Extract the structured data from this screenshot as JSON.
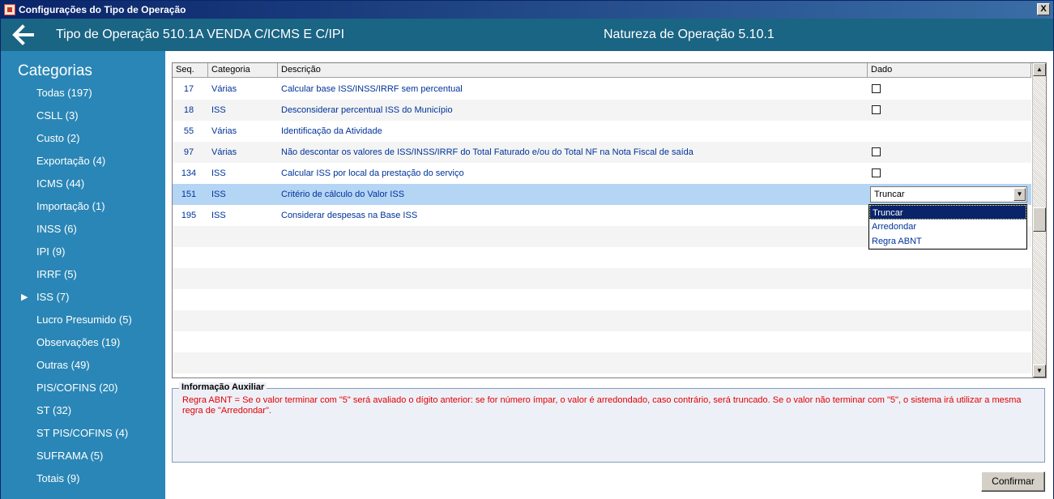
{
  "window": {
    "title": "Configurações do Tipo de Operação",
    "close_label": "X"
  },
  "header": {
    "operation_title": "Tipo de Operação 510.1A  VENDA C/ICMS E C/IPI",
    "nature_title": "Natureza de Operação 5.10.1"
  },
  "sidebar": {
    "title": "Categorias",
    "selected_index": 9,
    "items": [
      {
        "label": "Todas (197)"
      },
      {
        "label": "CSLL (3)"
      },
      {
        "label": "Custo (2)"
      },
      {
        "label": "Exportação (4)"
      },
      {
        "label": "ICMS (44)"
      },
      {
        "label": "Importação (1)"
      },
      {
        "label": "INSS (6)"
      },
      {
        "label": "IPI (9)"
      },
      {
        "label": "IRRF (5)"
      },
      {
        "label": "ISS (7)"
      },
      {
        "label": "Lucro Presumido (5)"
      },
      {
        "label": "Observações (19)"
      },
      {
        "label": "Outras (49)"
      },
      {
        "label": "PIS/COFINS (20)"
      },
      {
        "label": "ST (32)"
      },
      {
        "label": "ST PIS/COFINS (4)"
      },
      {
        "label": "SUFRAMA (5)"
      },
      {
        "label": "Totais (9)"
      }
    ]
  },
  "grid": {
    "columns": {
      "seq": "Seq.",
      "categoria": "Categoria",
      "descricao": "Descrição",
      "dado": "Dado"
    },
    "rows": [
      {
        "seq": "17",
        "categoria": "Várias",
        "descricao": "Calcular base ISS/INSS/IRRF sem percentual",
        "dado_type": "checkbox",
        "checked": false
      },
      {
        "seq": "18",
        "categoria": "ISS",
        "descricao": "Desconsiderar percentual ISS do Município",
        "dado_type": "checkbox",
        "checked": false
      },
      {
        "seq": "55",
        "categoria": "Várias",
        "descricao": "Identificação da Atividade",
        "dado_type": "none"
      },
      {
        "seq": "97",
        "categoria": "Várias",
        "descricao": "Não descontar os valores de ISS/INSS/IRRF do Total Faturado e/ou do Total NF na Nota Fiscal de saída",
        "dado_type": "checkbox",
        "checked": false
      },
      {
        "seq": "134",
        "categoria": "ISS",
        "descricao": "Calcular ISS por local da prestação do serviço",
        "dado_type": "checkbox",
        "checked": false
      },
      {
        "seq": "151",
        "categoria": "ISS",
        "descricao": "Critério de cálculo do Valor ISS",
        "dado_type": "combo",
        "value": "Truncar"
      },
      {
        "seq": "195",
        "categoria": "ISS",
        "descricao": "Considerar despesas na Base ISS",
        "dado_type": "none"
      }
    ],
    "dropdown": {
      "options": [
        "Truncar",
        "Arredondar",
        "Regra ABNT"
      ],
      "active_index": 0
    }
  },
  "aux": {
    "title": "Informação Auxiliar",
    "text": "Regra ABNT = Se o valor terminar com \"5\" será avaliado o dígito anterior: se for número ímpar, o valor é arredondado, caso contrário, será truncado. Se o valor não terminar com \"5\", o sistema irá utilizar a mesma regra de \"Arredondar\"."
  },
  "buttons": {
    "confirm": "Confirmar"
  },
  "colors": {
    "header_bg": "#1a6484",
    "sidebar_bg": "#2a86b6",
    "selected_row": "#b5d5f5",
    "aux_text": "#e00000"
  }
}
